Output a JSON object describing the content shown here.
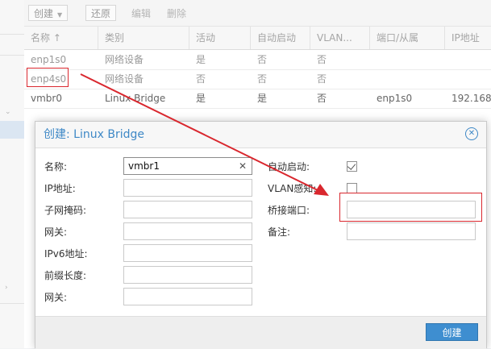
{
  "toolbar": {
    "create_label": "创建",
    "revert_label": "还原",
    "edit_label": "编辑",
    "delete_label": "删除"
  },
  "grid": {
    "columns": [
      "名称 ↑",
      "类别",
      "活动",
      "自动启动",
      "VLAN...",
      "端口/从属",
      "IP地址"
    ],
    "rows": [
      {
        "name": "enp1s0",
        "type": "网络设备",
        "active": "是",
        "autostart": "否",
        "vlan": "否",
        "ports": "",
        "ip": ""
      },
      {
        "name": "enp4s0",
        "type": "网络设备",
        "active": "否",
        "autostart": "否",
        "vlan": "否",
        "ports": "",
        "ip": ""
      },
      {
        "name": "vmbr0",
        "type": "Linux Bridge",
        "active": "是",
        "autostart": "是",
        "vlan": "否",
        "ports": "enp1s0",
        "ip": "192.168."
      }
    ]
  },
  "dialog": {
    "title": "创建: Linux Bridge",
    "left_fields": [
      {
        "label": "名称:",
        "value": "vmbr1"
      },
      {
        "label": "IP地址:",
        "value": ""
      },
      {
        "label": "子网掩码:",
        "value": ""
      },
      {
        "label": "网关:",
        "value": ""
      },
      {
        "label": "IPv6地址:",
        "value": ""
      },
      {
        "label": "前缀长度:",
        "value": ""
      },
      {
        "label": "网关:",
        "value": ""
      }
    ],
    "autostart_label": "自动启动:",
    "autostart_checked": true,
    "vlan_label": "VLAN感知:",
    "vlan_checked": false,
    "bridge_ports_label": "桥接端口:",
    "bridge_ports_value": "",
    "comment_label": "备注:",
    "comment_value": "",
    "create_button": "创建"
  },
  "colors": {
    "accent": "#3e88c6",
    "button": "#3e8ed0",
    "highlight": "#d9272e"
  }
}
